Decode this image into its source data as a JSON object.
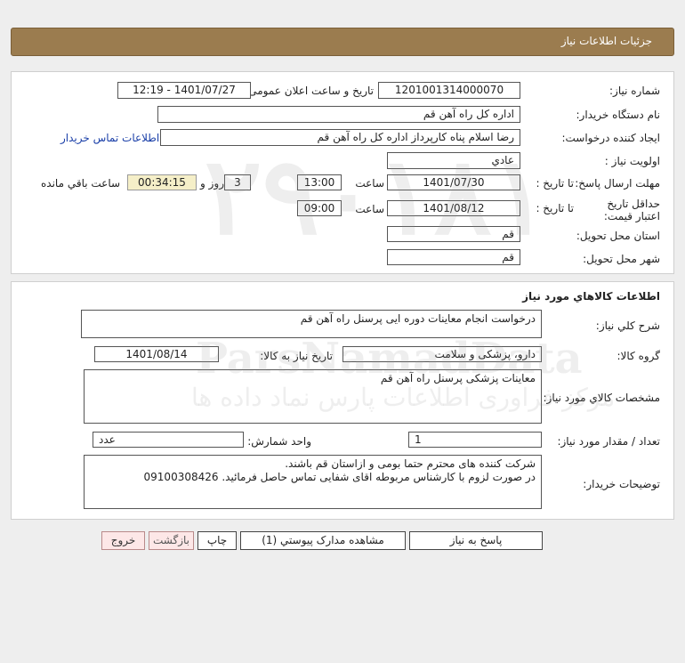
{
  "header": {
    "title": "جزئیات اطلاعات نیاز"
  },
  "info": {
    "need_number_label": "شماره نیاز:",
    "need_number": "1201001314000070",
    "announce_label": "تاریخ و ساعت اعلان عمومی:",
    "announce_value": "1401/07/27 - 12:19",
    "buyer_org_label": "نام دستگاه خريدار:",
    "buyer_org": "اداره کل  راه آهن قم",
    "creator_label": "ايجاد کننده درخواست:",
    "creator": "رضا اسلام پناه کارپرداز اداره کل  راه آهن قم",
    "contact_link": "اطلاعات تماس خريدار",
    "priority_label": "اولويت نياز :",
    "priority": "عادي",
    "deadline_label": "مهلت ارسال پاسخ:",
    "to_date_label": "تا تاريخ :",
    "deadline_date": "1401/07/30",
    "time_label": "ساعت",
    "deadline_time": "13:00",
    "days_value": "3",
    "days_label": "روز و",
    "remaining_time": "00:34:15",
    "remaining_label": "ساعت باقي مانده",
    "validity_label": "حداقل تاريخ اعتبار قيمت:",
    "validity_date": "1401/08/12",
    "validity_time": "09:00",
    "province_label": "استان محل تحويل:",
    "province": "قم",
    "city_label": "شهر محل تحويل:",
    "city": "قم"
  },
  "goods": {
    "title": "اطلاعات کالاهاي مورد نياز",
    "summary_label": "شرح کلي نياز:",
    "summary": "درخواست انجام معاينات دوره ايی پرسنل راه آهن قم",
    "group_label": "گروه کالا:",
    "group": "دارو، پزشکی و سلامت",
    "need_date_label": "تاريخ نياز به کالا:",
    "need_date": "1401/08/14",
    "specs_label": "مشخصات کالاي مورد نياز:",
    "specs": "معاينات پزشكی پرسنل راه آهن قم",
    "qty_label": "تعداد / مقدار مورد نياز:",
    "qty": "1",
    "unit_label": "واحد شمارش:",
    "unit": "عدد",
    "notes_label": "توضيحات خريدار:",
    "notes_line1": "شركت كننده های محترم حتما بومی و ازاستان قم باشند.",
    "notes_line2": "در صورت لزوم با کارشناس مربوطه اقای شفايی تماس حاصل فرمائيد. 09100308426"
  },
  "buttons": {
    "reply": "پاسخ به نياز",
    "attachments": "مشاهده مدارک پيوستي (1)",
    "print": "چاپ",
    "back": "بازگشت",
    "exit": "خروج"
  }
}
